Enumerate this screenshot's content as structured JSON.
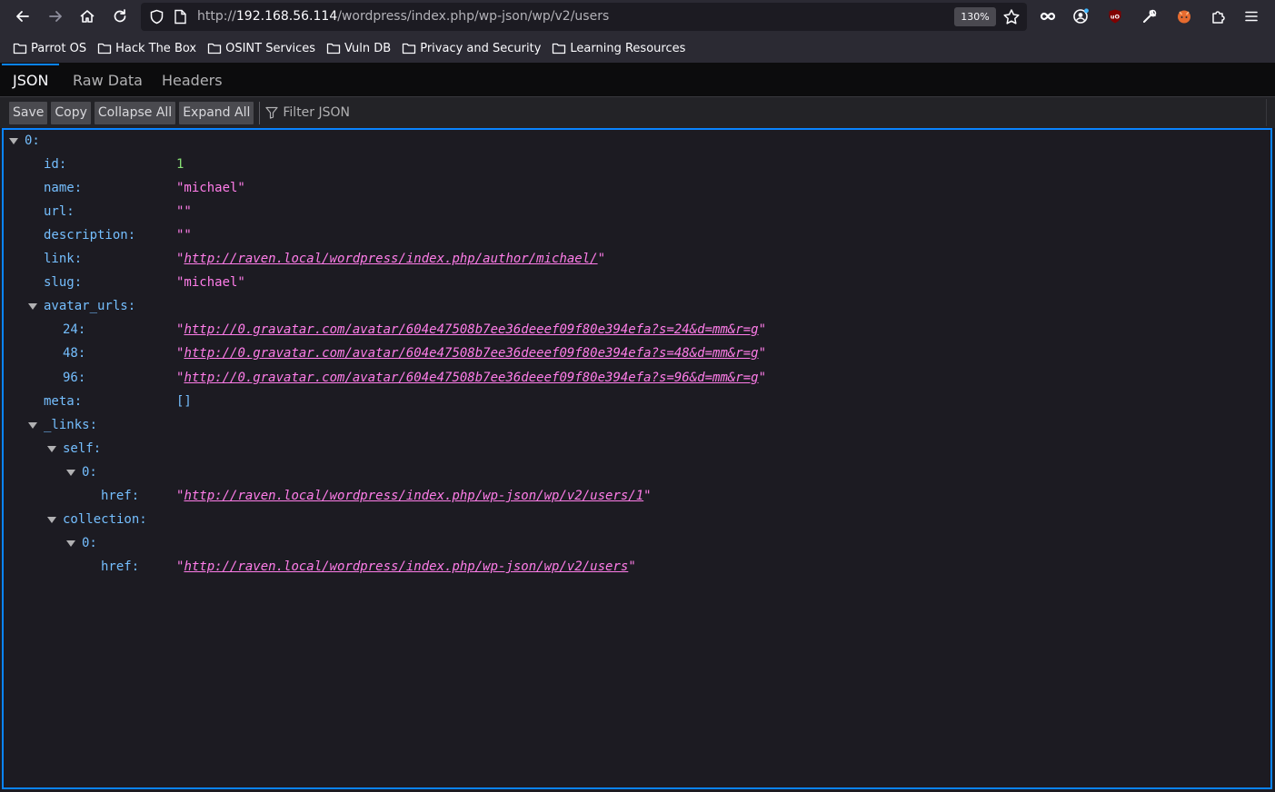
{
  "browser": {
    "url_scheme": "http://",
    "url_host": "192.168.56.114",
    "url_path": "/wordpress/index.php/wp-json/wp/v2/users",
    "zoom": "130%",
    "icons": {
      "back": "arrow-left-icon",
      "forward": "arrow-right-icon",
      "home": "home-icon",
      "reload": "reload-icon",
      "tracking": "shield-icon",
      "page_info": "page-icon",
      "bookmark": "star-icon",
      "extensions": [
        "infinity-icon",
        "account-icon",
        "ublock-icon",
        "wrench-icon",
        "foxyproxy-icon",
        "puzzle-icon",
        "menu-icon"
      ]
    },
    "colors": {
      "accent": "#0a84ff",
      "string": "#ff7de9",
      "number": "#86de74",
      "key": "#75bfff"
    }
  },
  "bookmarks": [
    "Parrot OS",
    "Hack The Box",
    "OSINT Services",
    "Vuln DB",
    "Privacy and Security",
    "Learning Resources"
  ],
  "viewer": {
    "tabs": [
      "JSON",
      "Raw Data",
      "Headers"
    ],
    "active_tab": "JSON",
    "toolbar": {
      "save": "Save",
      "copy": "Copy",
      "collapse": "Collapse All",
      "expand": "Expand All",
      "filter_placeholder": "Filter JSON"
    }
  },
  "tree": {
    "root_key": "0:",
    "id": {
      "key": "id:",
      "value": "1"
    },
    "name": {
      "key": "name:",
      "value": "\"michael\""
    },
    "url": {
      "key": "url:",
      "value": "\"\""
    },
    "description": {
      "key": "description:",
      "value": "\"\""
    },
    "link": {
      "key": "link:",
      "value": "http://raven.local/wordpress/index.php/author/michael/"
    },
    "slug": {
      "key": "slug:",
      "value": "\"michael\""
    },
    "avatar_urls": {
      "key": "avatar_urls:",
      "items": [
        {
          "key": "24:",
          "value": "http://0.gravatar.com/avatar/604e47508b7ee36deeef09f80e394efa?s=24&d=mm&r=g"
        },
        {
          "key": "48:",
          "value": "http://0.gravatar.com/avatar/604e47508b7ee36deeef09f80e394efa?s=48&d=mm&r=g"
        },
        {
          "key": "96:",
          "value": "http://0.gravatar.com/avatar/604e47508b7ee36deeef09f80e394efa?s=96&d=mm&r=g"
        }
      ]
    },
    "meta": {
      "key": "meta:",
      "value": "[]"
    },
    "links": {
      "key": "_links:",
      "self": {
        "key": "self:",
        "index": "0:",
        "href_key": "href:",
        "href": "http://raven.local/wordpress/index.php/wp-json/wp/v2/users/1"
      },
      "collection": {
        "key": "collection:",
        "index": "0:",
        "href_key": "href:",
        "href": "http://raven.local/wordpress/index.php/wp-json/wp/v2/users"
      }
    }
  }
}
